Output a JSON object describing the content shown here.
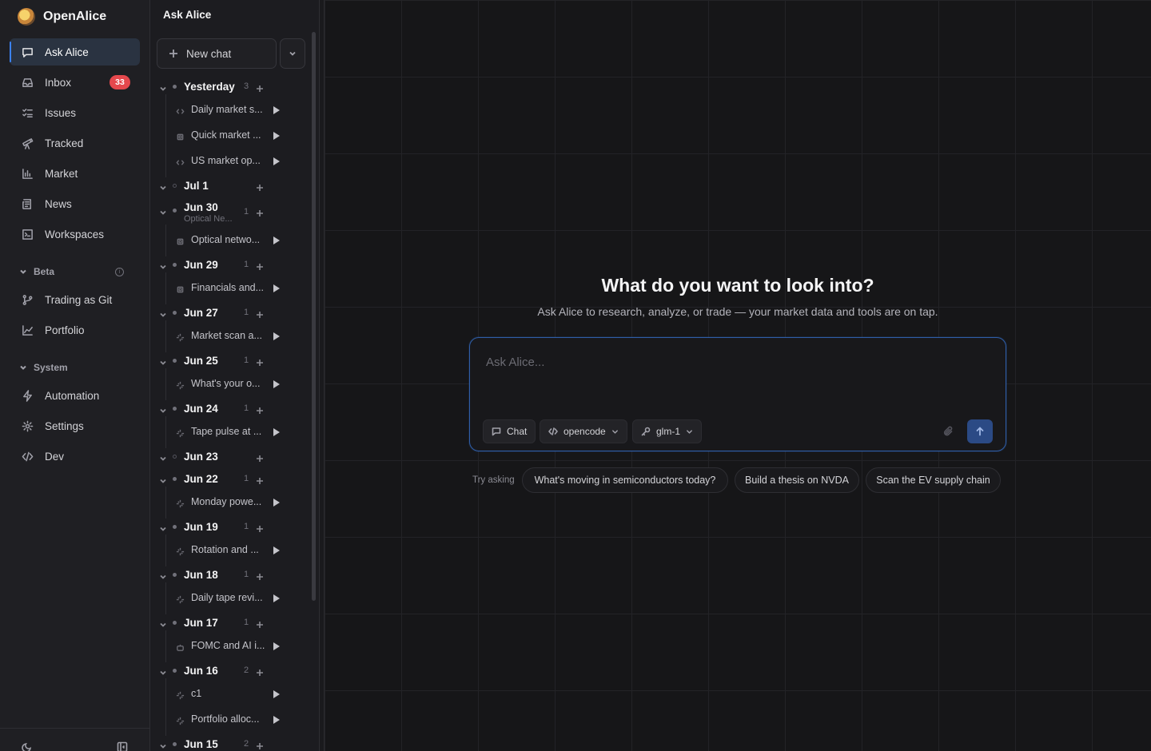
{
  "app": {
    "name": "OpenAlice"
  },
  "nav": {
    "items": [
      {
        "label": "Ask Alice",
        "icon": "message-square-icon"
      },
      {
        "label": "Inbox",
        "icon": "inbox-icon",
        "badge": "33"
      },
      {
        "label": "Issues",
        "icon": "list-checks-icon"
      },
      {
        "label": "Tracked",
        "icon": "telescope-icon"
      },
      {
        "label": "Market",
        "icon": "bar-chart-icon"
      },
      {
        "label": "News",
        "icon": "newspaper-icon"
      },
      {
        "label": "Workspaces",
        "icon": "terminal-square-icon"
      }
    ],
    "beta": {
      "label": "Beta",
      "items": [
        {
          "label": "Trading as Git",
          "icon": "git-branch-icon"
        },
        {
          "label": "Portfolio",
          "icon": "line-chart-icon"
        }
      ]
    },
    "system": {
      "label": "System",
      "items": [
        {
          "label": "Automation",
          "icon": "zap-icon"
        },
        {
          "label": "Settings",
          "icon": "gear-icon"
        },
        {
          "label": "Dev",
          "icon": "code-icon"
        }
      ]
    }
  },
  "chats": {
    "title": "Ask Alice",
    "new_chat_label": "New chat",
    "groups": [
      {
        "label": "Yesterday",
        "count": "3",
        "chats": [
          {
            "title": "Daily market s...",
            "icon": "code-icon"
          },
          {
            "title": "Quick market ...",
            "icon": "cpu-icon"
          },
          {
            "title": "US market op...",
            "icon": "code-icon"
          }
        ]
      },
      {
        "label": "Jul 1",
        "count": "",
        "hollow": true,
        "chats": []
      },
      {
        "label": "Jun 30",
        "sub": "Optical Ne...",
        "count": "1",
        "chats": [
          {
            "title": "Optical netwo...",
            "icon": "cpu-icon"
          }
        ]
      },
      {
        "label": "Jun 29",
        "count": "1",
        "chats": [
          {
            "title": "Financials and...",
            "icon": "cpu-icon"
          }
        ]
      },
      {
        "label": "Jun 27",
        "count": "1",
        "chats": [
          {
            "title": "Market scan a...",
            "icon": "sparkles-icon"
          }
        ]
      },
      {
        "label": "Jun 25",
        "count": "1",
        "chats": [
          {
            "title": "What's your o...",
            "icon": "sparkles-icon"
          }
        ]
      },
      {
        "label": "Jun 24",
        "count": "1",
        "chats": [
          {
            "title": "Tape pulse at ...",
            "icon": "sparkles-icon"
          }
        ]
      },
      {
        "label": "Jun 23",
        "count": "",
        "hollow": true,
        "chats": []
      },
      {
        "label": "Jun 22",
        "count": "1",
        "chats": [
          {
            "title": "Monday powe...",
            "icon": "sparkles-icon"
          }
        ]
      },
      {
        "label": "Jun 19",
        "count": "1",
        "chats": [
          {
            "title": "Rotation and ...",
            "icon": "sparkles-icon"
          }
        ]
      },
      {
        "label": "Jun 18",
        "count": "1",
        "chats": [
          {
            "title": "Daily tape revi...",
            "icon": "sparkles-icon"
          }
        ]
      },
      {
        "label": "Jun 17",
        "count": "1",
        "chats": [
          {
            "title": "FOMC and AI i...",
            "icon": "bot-icon"
          }
        ]
      },
      {
        "label": "Jun 16",
        "count": "2",
        "chats": [
          {
            "title": "c1",
            "icon": "sparkles-icon"
          },
          {
            "title": "Portfolio alloc...",
            "icon": "sparkles-icon"
          }
        ]
      },
      {
        "label": "Jun 15",
        "count": "2",
        "chats": []
      }
    ]
  },
  "main": {
    "title": "What do you want to look into?",
    "subtitle": "Ask Alice to research, analyze, or trade — your market data and tools are on tap.",
    "input_placeholder": "Ask Alice...",
    "chips": {
      "mode": "Chat",
      "agent": "opencode",
      "model": "glm-1"
    },
    "try_label": "Try asking",
    "suggestions": [
      "What's moving in semiconductors today?",
      "Build a thesis on NVDA",
      "Scan the EV supply chain"
    ]
  },
  "colors": {
    "accent": "#3b82f6",
    "badge": "#e5484d",
    "send": "#2b4a85"
  }
}
